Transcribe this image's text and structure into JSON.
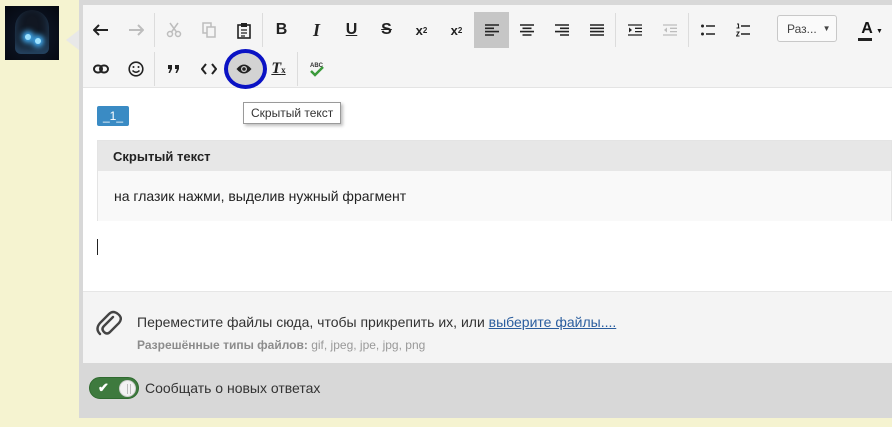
{
  "toolbar": {
    "size_label": "Раз...",
    "color_label": "A"
  },
  "icons": {
    "undo": "undo-icon",
    "redo": "redo-icon",
    "cut": "cut-icon",
    "copy": "copy-icon",
    "paste": "paste-icon",
    "link": "link-icon",
    "smilie": "smilie-icon",
    "quote": "quote-icon",
    "code": "code-icon",
    "hide": "eye-icon",
    "clear_format": "remove-format-icon",
    "spell": "spellcheck-icon",
    "attach": "paperclip-icon"
  },
  "formatting": {
    "bold": "B",
    "italic": "I",
    "underline": "U",
    "strike": "S",
    "sup_base": "x",
    "sup_mark": "2",
    "sub_base": "x",
    "sub_mark": "2",
    "clear_base": "T",
    "clear_mark": "x",
    "spell_mark": "ABC"
  },
  "tooltip": {
    "text": "Скрытый текст"
  },
  "content": {
    "tag": "_1_",
    "spoiler_title": "Скрытый текст",
    "spoiler_body": "на глазик нажми, выделив нужный фрагмент"
  },
  "attach": {
    "text": "Переместите файлы сюда, чтобы прикрепить их, или ",
    "link": "выберите файлы....",
    "types_label": "Разрешённые типы файлов:",
    "types": " gif, jpeg, jpe, jpg, png"
  },
  "notify": {
    "label": "Сообщать о новых ответах",
    "on": true
  },
  "colors": {
    "page_bg": "#f5f3d0",
    "tag_bg": "#3a8bc4",
    "highlight_ring": "#0a12c4",
    "toggle_on": "#3e7a3e",
    "link": "#2a5d9e"
  }
}
